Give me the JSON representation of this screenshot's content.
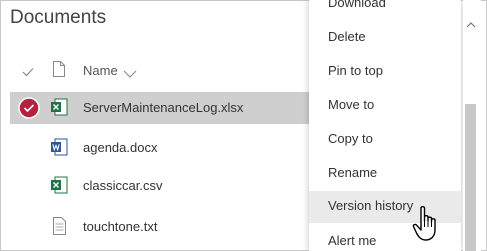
{
  "page": {
    "title": "Documents"
  },
  "columns": {
    "name_label": "Name"
  },
  "files": [
    {
      "name": "ServerMaintenanceLog.xlsx",
      "type": "excel",
      "selected": true
    },
    {
      "name": "agenda.docx",
      "type": "word",
      "selected": false
    },
    {
      "name": "classiccar.csv",
      "type": "excel",
      "selected": false
    },
    {
      "name": "touchtone.txt",
      "type": "text",
      "selected": false
    }
  ],
  "context_menu": {
    "items": [
      {
        "label": "Download"
      },
      {
        "label": "Delete"
      },
      {
        "label": "Pin to top"
      },
      {
        "label": "Move to"
      },
      {
        "label": "Copy to"
      },
      {
        "label": "Rename"
      },
      {
        "label": "Version history",
        "hovered": true
      },
      {
        "label": "Alert me"
      }
    ]
  },
  "icons": {
    "check": "checkmark-icon",
    "file_type": "document-icon",
    "sort": "chevron-down-icon",
    "selected_row": "selected-check-circle-icon",
    "excel": "excel-file-icon",
    "word": "word-file-icon",
    "text": "text-file-icon",
    "cursor": "hand-pointer-icon"
  },
  "colors": {
    "selected_row_bg": "#cfcfcf",
    "selected_check": "#b3223f",
    "excel_green": "#217346",
    "word_blue": "#2b579a",
    "menu_hover": "#eaeaea"
  }
}
